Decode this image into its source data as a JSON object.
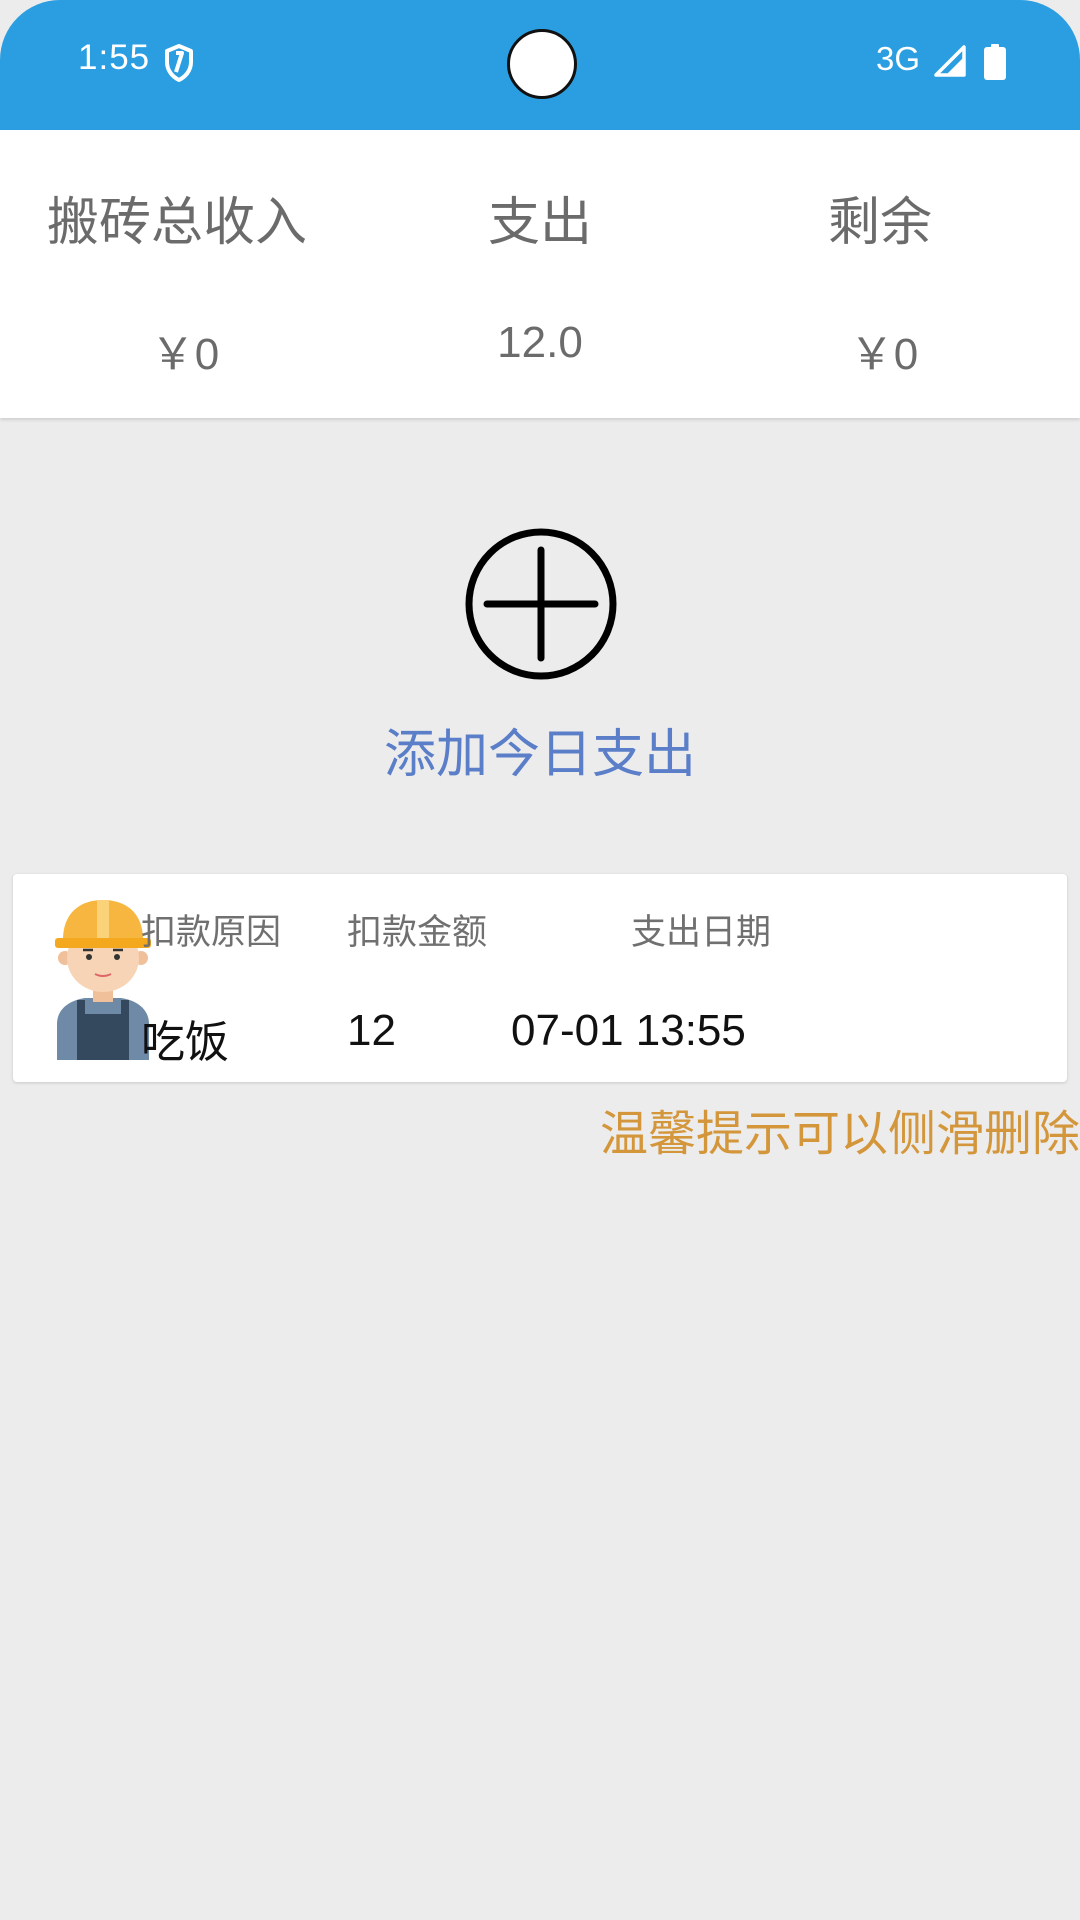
{
  "status_bar": {
    "time": "1:55",
    "network": "3G",
    "color": "#2b9ee2"
  },
  "summary": {
    "columns": [
      {
        "label": "搬砖总收入",
        "value": "￥0"
      },
      {
        "label": "支出",
        "value": "12.0"
      },
      {
        "label": "剩余",
        "value": "￥0"
      }
    ]
  },
  "add_action": {
    "label": "添加今日支出",
    "icon": "plus-circle-icon",
    "color": "#5b7ec9"
  },
  "records": {
    "headers": {
      "reason": "扣款原因",
      "amount": "扣款金额",
      "date": "支出日期"
    },
    "items": [
      {
        "avatar": "worker-avatar",
        "reason": "吃饭",
        "amount": "12",
        "date": "07-01 13:55"
      }
    ]
  },
  "tip": {
    "text": "温馨提示可以侧滑删除",
    "color": "#d4963b"
  }
}
